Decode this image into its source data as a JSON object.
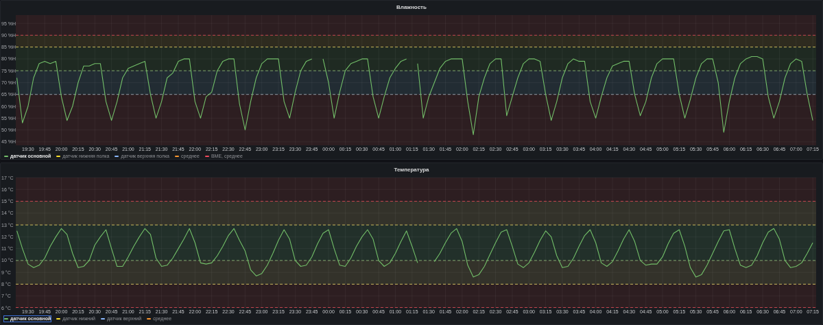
{
  "panels": [
    {
      "title": "Влажность",
      "chart_data": {
        "type": "line",
        "ylim": [
          43.5,
          98.5
        ],
        "yticks": [
          {
            "value": 45,
            "label": "45 %H"
          },
          {
            "value": 50,
            "label": "50 %H"
          },
          {
            "value": 55,
            "label": "55 %H"
          },
          {
            "value": 60,
            "label": "60 %H"
          },
          {
            "value": 65,
            "label": "65 %H"
          },
          {
            "value": 70,
            "label": "70 %H"
          },
          {
            "value": 75,
            "label": "75 %H"
          },
          {
            "value": 80,
            "label": "80 %H"
          },
          {
            "value": 85,
            "label": "85 %H"
          },
          {
            "value": 90,
            "label": "90 %H"
          },
          {
            "value": 95,
            "label": "95 %H"
          }
        ],
        "categories": [
          null,
          null,
          "19:30",
          null,
          null,
          "19:45",
          null,
          null,
          "20:00",
          null,
          null,
          "20:15",
          null,
          null,
          "20:30",
          null,
          null,
          "20:45",
          null,
          null,
          "21:00",
          null,
          null,
          "21:15",
          null,
          null,
          "21:30",
          null,
          null,
          "21:45",
          null,
          null,
          "22:00",
          null,
          null,
          "22:15",
          null,
          null,
          "22:30",
          null,
          null,
          "22:45",
          null,
          null,
          "23:00",
          null,
          null,
          "23:15",
          null,
          null,
          "23:30",
          null,
          null,
          "23:45",
          null,
          null,
          "00:00",
          null,
          null,
          "00:15",
          null,
          null,
          "00:30",
          null,
          null,
          "00:45",
          null,
          null,
          "01:00",
          null,
          null,
          "01:15",
          null,
          null,
          "01:30",
          null,
          null,
          "01:45",
          null,
          null,
          "02:00",
          null,
          null,
          "02:15",
          null,
          null,
          "02:30",
          null,
          null,
          "02:45",
          null,
          null,
          "03:00",
          null,
          null,
          "03:15",
          null,
          null,
          "03:30",
          null,
          null,
          "03:45",
          null,
          null,
          "04:00",
          null,
          null,
          "04:15",
          null,
          null,
          "04:30",
          null,
          null,
          "04:45",
          null,
          null,
          "05:00",
          null,
          null,
          "05:15",
          null,
          null,
          "05:30",
          null,
          null,
          "05:45",
          null,
          null,
          "06:00",
          null,
          null,
          "06:15",
          null,
          null,
          "06:30",
          null,
          null,
          "06:45",
          null,
          null,
          "07:00",
          null,
          null,
          "07:15"
        ],
        "grid": true,
        "bands": [
          {
            "axis": "y",
            "from": 90,
            "to": 98.5,
            "color": "#2d1e21"
          },
          {
            "axis": "y",
            "from": 85,
            "to": 90,
            "color": "#2e2b1f"
          },
          {
            "axis": "y",
            "from": 75,
            "to": 85,
            "color": "#1f2a22"
          },
          {
            "axis": "y",
            "from": 65,
            "to": 75,
            "color": "#222c33"
          },
          {
            "axis": "y",
            "from": 43.5,
            "to": 65,
            "color": "#2d1e21"
          }
        ],
        "ref_lines": [
          {
            "axis": "y",
            "value": 90,
            "color": "#c4464f"
          },
          {
            "axis": "y",
            "value": 85,
            "color": "#c9b85a"
          },
          {
            "axis": "y",
            "value": 75,
            "color": "#7fa36b"
          },
          {
            "axis": "y",
            "value": 65,
            "color": "#8f9aa6"
          }
        ],
        "series": [
          {
            "color": "#73bf69",
            "values": [
              72,
              53,
              60,
              72,
              78,
              79,
              78,
              79,
              64,
              54,
              60,
              70,
              77,
              77,
              78,
              78,
              62,
              54,
              62,
              72,
              76,
              77,
              78,
              79,
              65,
              55,
              62,
              72,
              74,
              79,
              80,
              80,
              62,
              55,
              64,
              66,
              75,
              79,
              80,
              80,
              61,
              50,
              62,
              72,
              78,
              80,
              80,
              80,
              62,
              55,
              66,
              75,
              79,
              80,
              null,
              80,
              70,
              55,
              66,
              75,
              78,
              79,
              80,
              80,
              64,
              55,
              64,
              72,
              76,
              79,
              80,
              null,
              78,
              55,
              64,
              70,
              76,
              79,
              80,
              80,
              80,
              62,
              48,
              64,
              72,
              78,
              80,
              80,
              56,
              64,
              72,
              78,
              80,
              80,
              79,
              65,
              54,
              62,
              72,
              78,
              80,
              79,
              79,
              62,
              55,
              64,
              72,
              77,
              78,
              79,
              79,
              65,
              56,
              62,
              72,
              78,
              80,
              80,
              80,
              65,
              55,
              63,
              72,
              78,
              80,
              80,
              70,
              49,
              62,
              72,
              78,
              80,
              81,
              81,
              80,
              64,
              55,
              62,
              72,
              78,
              80,
              79,
              65,
              54
            ]
          }
        ]
      },
      "legend": [
        {
          "label": "датчик основной",
          "color": "#73bf69",
          "selected": true,
          "focused": false
        },
        {
          "label": "датчик нижняя полка",
          "color": "#fade2a",
          "selected": false,
          "focused": false
        },
        {
          "label": "датчик верхняя полка",
          "color": "#8ab8ff",
          "selected": false,
          "focused": false
        },
        {
          "label": "среднее",
          "color": "#ff9830",
          "selected": false,
          "focused": false
        },
        {
          "label": "BME, среднее",
          "color": "#f2495c",
          "selected": false,
          "focused": false
        }
      ]
    },
    {
      "title": "Температура",
      "chart_data": {
        "type": "line",
        "ylim": [
          6,
          17
        ],
        "yticks": [
          {
            "value": 6,
            "label": "6 °C"
          },
          {
            "value": 7,
            "label": "7 °C"
          },
          {
            "value": 8,
            "label": "8 °C"
          },
          {
            "value": 9,
            "label": "9 °C"
          },
          {
            "value": 10,
            "label": "10 °C"
          },
          {
            "value": 11,
            "label": "11 °C"
          },
          {
            "value": 12,
            "label": "12 °C"
          },
          {
            "value": 13,
            "label": "13 °C"
          },
          {
            "value": 14,
            "label": "14 °C"
          },
          {
            "value": 15,
            "label": "15 °C"
          },
          {
            "value": 16,
            "label": "16 °C"
          },
          {
            "value": 17,
            "label": "17 °C"
          }
        ],
        "categories": [
          null,
          null,
          "19:30",
          null,
          null,
          "19:45",
          null,
          null,
          "20:00",
          null,
          null,
          "20:15",
          null,
          null,
          "20:30",
          null,
          null,
          "20:45",
          null,
          null,
          "21:00",
          null,
          null,
          "21:15",
          null,
          null,
          "21:30",
          null,
          null,
          "21:45",
          null,
          null,
          "22:00",
          null,
          null,
          "22:15",
          null,
          null,
          "22:30",
          null,
          null,
          "22:45",
          null,
          null,
          "23:00",
          null,
          null,
          "23:15",
          null,
          null,
          "23:30",
          null,
          null,
          "23:45",
          null,
          null,
          "00:00",
          null,
          null,
          "00:15",
          null,
          null,
          "00:30",
          null,
          null,
          "00:45",
          null,
          null,
          "01:00",
          null,
          null,
          "01:15",
          null,
          null,
          "01:30",
          null,
          null,
          "01:45",
          null,
          null,
          "02:00",
          null,
          null,
          "02:15",
          null,
          null,
          "02:30",
          null,
          null,
          "02:45",
          null,
          null,
          "03:00",
          null,
          null,
          "03:15",
          null,
          null,
          "03:30",
          null,
          null,
          "03:45",
          null,
          null,
          "04:00",
          null,
          null,
          "04:15",
          null,
          null,
          "04:30",
          null,
          null,
          "04:45",
          null,
          null,
          "05:00",
          null,
          null,
          "05:15",
          null,
          null,
          "05:30",
          null,
          null,
          "05:45",
          null,
          null,
          "06:00",
          null,
          null,
          "06:15",
          null,
          null,
          "06:30",
          null,
          null,
          "06:45",
          null,
          null,
          "07:00",
          null,
          null,
          "07:15"
        ],
        "grid": true,
        "bands": [
          {
            "axis": "y",
            "from": 15,
            "to": 17,
            "color": "#2d1e21"
          },
          {
            "axis": "y",
            "from": 13,
            "to": 15,
            "color": "#33322a"
          },
          {
            "axis": "y",
            "from": 10,
            "to": 13,
            "color": "#22302a"
          },
          {
            "axis": "y",
            "from": 8,
            "to": 10,
            "color": "#33322a"
          },
          {
            "axis": "y",
            "from": 6,
            "to": 8,
            "color": "#2d1e21"
          }
        ],
        "ref_lines": [
          {
            "axis": "y",
            "value": 15,
            "color": "#c4464f"
          },
          {
            "axis": "y",
            "value": 13,
            "color": "#c9b85a"
          },
          {
            "axis": "y",
            "value": 10,
            "color": "#80a46c"
          },
          {
            "axis": "y",
            "value": 8,
            "color": "#c7b65c"
          },
          {
            "axis": "y",
            "value": 6,
            "color": "#c2444d"
          }
        ],
        "series": [
          {
            "color": "#73bf69",
            "values": [
              12.5,
              11.0,
              9.7,
              9.4,
              9.6,
              10.2,
              11.2,
              12.0,
              12.7,
              12.2,
              10.6,
              9.4,
              9.5,
              10.0,
              11.3,
              12.0,
              12.6,
              11.0,
              9.5,
              9.5,
              10.3,
              11.2,
              12.0,
              12.7,
              12.2,
              10.2,
              9.5,
              9.6,
              10.2,
              11.0,
              11.8,
              12.7,
              11.5,
              9.8,
              9.7,
              9.8,
              10.4,
              11.2,
              12.1,
              12.7,
              11.7,
              10.8,
              9.2,
              8.7,
              8.9,
              9.6,
              10.6,
              11.7,
              12.6,
              11.8,
              10.0,
              9.5,
              9.6,
              10.3,
              11.4,
              12.3,
              12.6,
              11.0,
              9.6,
              9.5,
              10.2,
              11.2,
              12.0,
              12.6,
              11.8,
              10.0,
              9.5,
              9.8,
              10.6,
              11.6,
              12.5,
              11.2,
              9.8,
              null,
              null,
              9.9,
              10.6,
              11.5,
              12.3,
              12.7,
              11.6,
              9.6,
              8.6,
              8.8,
              9.5,
              10.5,
              11.5,
              12.4,
              12.6,
              11.2,
              9.7,
              9.4,
              9.8,
              10.7,
              11.7,
              12.5,
              12.0,
              10.4,
              9.4,
              9.5,
              10.2,
              11.2,
              12.1,
              12.6,
              11.5,
              9.8,
              9.5,
              9.9,
              10.8,
              11.8,
              12.6,
              11.6,
              10.0,
              9.6,
              9.7,
              9.7,
              10.3,
              11.4,
              12.3,
              12.6,
              11.2,
              9.4,
              8.6,
              8.8,
              9.6,
              10.6,
              11.6,
              12.5,
              12.6,
              11.0,
              9.6,
              9.4,
              9.6,
              10.4,
              11.5,
              12.4,
              12.7,
              11.8,
              10.0,
              9.4,
              9.5,
              9.8,
              10.6,
              11.5
            ]
          }
        ]
      },
      "legend": [
        {
          "label": "датчик основной",
          "color": "#73bf69",
          "selected": true,
          "focused": true
        },
        {
          "label": "датчик нижний",
          "color": "#fade2a",
          "selected": false,
          "focused": false
        },
        {
          "label": "датчик верхний",
          "color": "#8ab8ff",
          "selected": false,
          "focused": false
        },
        {
          "label": "среднее",
          "color": "#ff9830",
          "selected": false,
          "focused": false
        }
      ]
    }
  ]
}
